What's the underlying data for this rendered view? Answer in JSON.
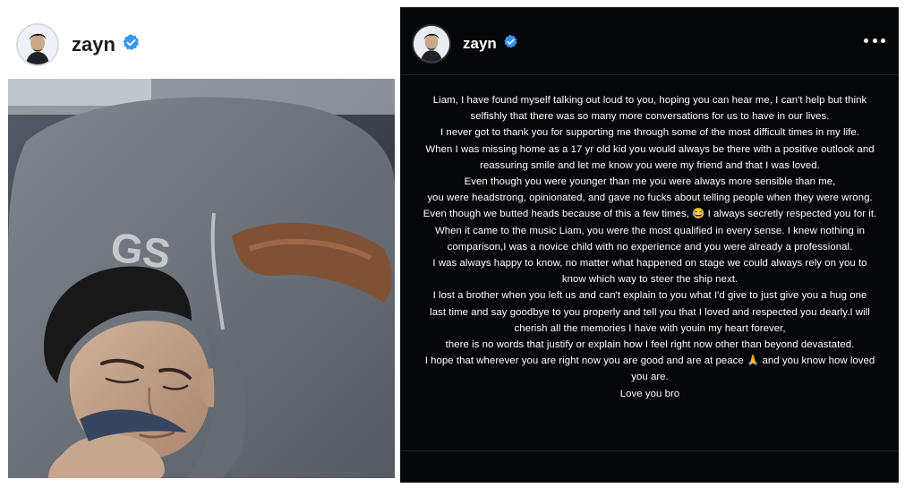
{
  "left_post": {
    "username": "zayn",
    "verified": true,
    "photo_icon": "photo-sleeping-person"
  },
  "right_post": {
    "username": "zayn",
    "verified": true,
    "more_icon": "more-horizontal-icon",
    "message_lines": [
      "Liam, I have found myself talking out loud to you, hoping you can hear me, I can't help but think",
      "selfishly that there was so many more conversations for us to have in our lives.",
      "I never got to thank you for supporting me through some of the most difficult times in my life.",
      "When I was missing home as a 17 yr old kid you would always be there with a positive outlook and",
      "reassuring smile and let me know you were my friend and that I was loved.",
      "Even though you were younger than me you were always more sensible than me,",
      "you were headstrong, opinionated, and gave no fucks about telling people when they were wrong.",
      "Even though we butted heads because of this a few times, 😂 I always secretly respected you for it.",
      "When it came to the music Liam, you were the most qualified in every sense. I knew nothing in",
      "comparison,I was a novice child with no experience and you were already a professional.",
      "I was always happy to know, no matter what happened on stage we could always rely on you to",
      "know which way to steer the ship next.",
      "I lost a brother when you left us and can't explain to you what I'd give to just give you a hug one",
      "last time and say goodbye to you properly and tell you that I loved and respected you  dearly.I will",
      "cherish all the memories I have with youin my heart forever,",
      "there is no words that justify or explain how I feel right now other than beyond devastated.",
      "I hope that wherever you are right now you are good and are at peace 🙏 and you know how loved",
      "you are.",
      "Love you bro"
    ]
  },
  "colors": {
    "verified_blue": "#3897f0",
    "story_background": "#050608",
    "text_dark": "#1b1b1b",
    "text_light": "#ffffff"
  }
}
